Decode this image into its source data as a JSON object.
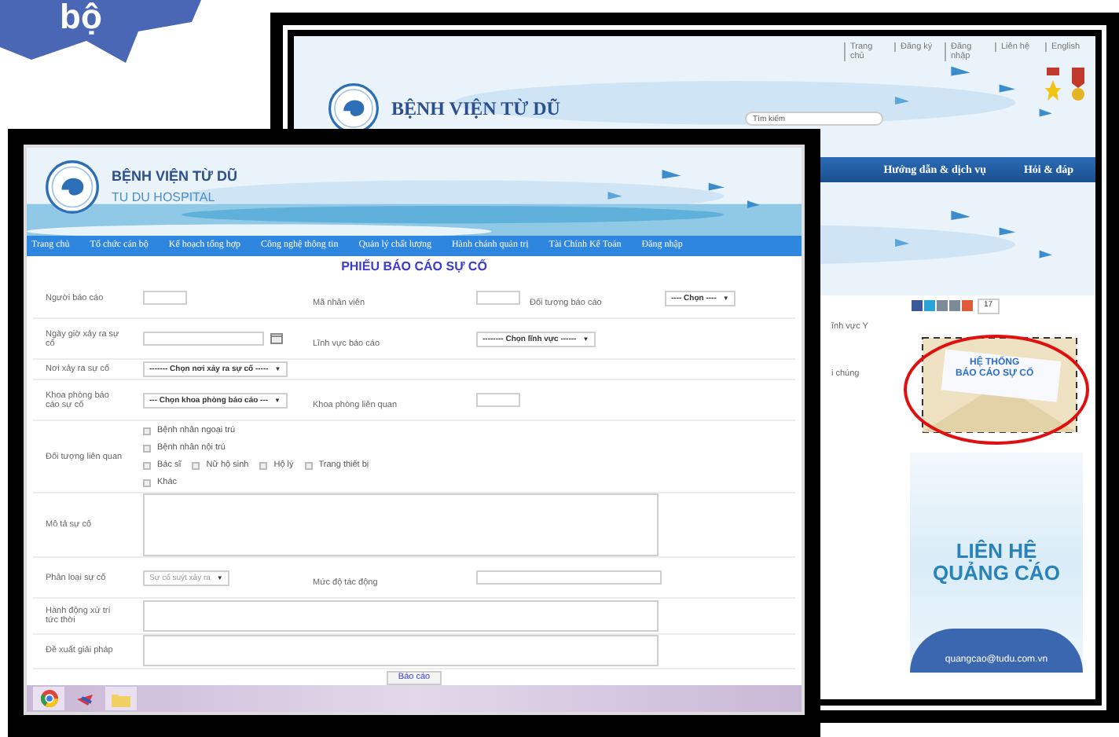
{
  "callout": {
    "text": "bộ"
  },
  "back_window": {
    "top_links": [
      "Trang chủ",
      "Đăng ký",
      "Đăng nhập",
      "Liên hệ",
      "English"
    ],
    "site_title": "BỆNH VIỆN TỪ DŨ",
    "search": {
      "placeholder": "Tìm kiếm"
    },
    "nav": [
      "Hướng dẫn & dịch vụ",
      "Hỏi & đáp"
    ],
    "text_fragments": [
      "ĩnh vực Y",
      "i chúng"
    ],
    "share_count": "17",
    "report_banner": [
      "HỆ THỐNG",
      "BÁO CÁO SỰ CỐ"
    ],
    "ad": {
      "title": [
        "LIÊN HỆ",
        "QUẢNG CÁO"
      ],
      "email": "quangcao@tudu.com.vn"
    }
  },
  "front_window": {
    "site_title": "BỆNH VIỆN TỪ DŨ",
    "site_subtitle": "TU DU HOSPITAL",
    "nav": [
      "Trang chủ",
      "Tổ chức cán bộ",
      "Kế hoạch tổng hợp",
      "Công nghệ thông tin",
      "Quản lý chất lượng",
      "Hành chánh quản trị",
      "Tài Chính Kế Toán",
      "Đăng nhập"
    ],
    "form": {
      "title": "PHIẾU BÁO CÁO SỰ CỐ",
      "rows": [
        {
          "label": "Người báo cáo",
          "field": {
            "kind": "input"
          },
          "label2": "Mã nhân viên",
          "field2": {
            "kind": "input"
          },
          "label3": "Đối tượng báo cáo",
          "field3": {
            "kind": "select",
            "value": "---- Chọn ----",
            "arrow": "▼"
          }
        },
        {
          "label": "Ngày giờ xảy ra sự cố",
          "field": {
            "kind": "date"
          },
          "label2": "Lĩnh vực báo cáo",
          "field2": {
            "kind": "select",
            "value": "-------- Chọn lĩnh vực ------",
            "arrow": "▼"
          }
        },
        {
          "label": "Nơi xảy ra sự cố",
          "field": {
            "kind": "select",
            "value": "------- Chọn nơi xảy ra sự cố -----",
            "arrow": "▼"
          }
        },
        {
          "label": "Khoa phòng báo cáo sự cố",
          "field": {
            "kind": "select",
            "value": "--- Chọn khoa phòng báo cáo ---",
            "arrow": "▼"
          },
          "label2": "Khoa phòng liên quan",
          "field2": {
            "kind": "input"
          }
        },
        {
          "label": "Đối tượng liên quan",
          "field": {
            "kind": "checkboxes",
            "lines": [
              [
                {
                  "label": "Bệnh nhân ngoại trú",
                  "checked": false
                }
              ],
              [
                {
                  "label": "Bệnh nhân nội trú",
                  "checked": false
                }
              ],
              [
                {
                  "label": "Bác sĩ",
                  "checked": false
                },
                {
                  "label": "Nữ hộ sinh",
                  "checked": false
                },
                {
                  "label": "Hộ lý",
                  "checked": false
                },
                {
                  "label": "Trang thiết bị",
                  "checked": false
                }
              ],
              [
                {
                  "label": "Khác",
                  "checked": false
                }
              ]
            ]
          }
        },
        {
          "label": "Mô tả sự cố",
          "field": {
            "kind": "tall_textarea"
          }
        },
        {
          "label": "Phân loại sự cố",
          "field": {
            "kind": "select",
            "value": "Sự cố suýt xảy ra",
            "arrow": "▼",
            "muted": true
          },
          "label2": "Mức độ tác động",
          "field2": {
            "kind": "input",
            "wide": true
          }
        },
        {
          "label": "Hành động xử trí tức thời",
          "field": {
            "kind": "textarea"
          }
        },
        {
          "label": "Đề xuất giải pháp",
          "field": {
            "kind": "textarea"
          }
        }
      ],
      "submit": "Báo cáo"
    }
  }
}
